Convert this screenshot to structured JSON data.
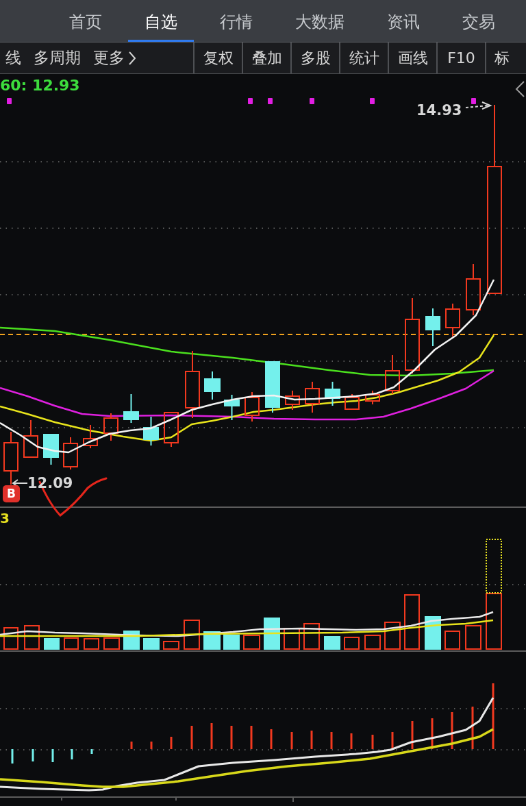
{
  "top_nav": {
    "tabs": [
      {
        "label": "首页",
        "selected": false
      },
      {
        "label": "自选",
        "selected": true
      },
      {
        "label": "行情",
        "selected": false
      },
      {
        "label": "大数据",
        "selected": false
      },
      {
        "label": "资讯",
        "selected": false
      },
      {
        "label": "交易",
        "selected": false
      }
    ]
  },
  "toolbar": {
    "period_items": [
      "线",
      "多周期"
    ],
    "more_menu": {
      "label": "更多"
    },
    "buttons": [
      "复权",
      "叠加",
      "多股",
      "统计",
      "画线",
      "F10",
      "标"
    ]
  },
  "price_chart": {
    "indicator_label": "60: 12.93",
    "high_label": "14.93",
    "low_label": "12.09",
    "buy_marker": {
      "label": "B"
    }
  },
  "volume_chart": {
    "indicator_label": "3"
  }
}
